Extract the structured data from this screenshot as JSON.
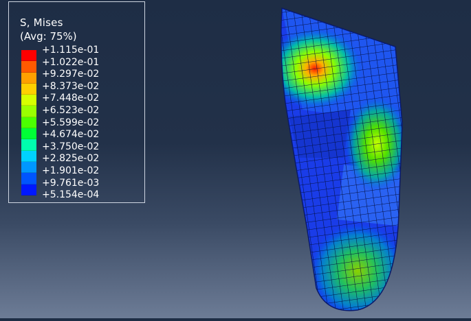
{
  "legend": {
    "title": "S, Mises",
    "subtitle": "(Avg: 75%)",
    "labels": [
      "+1.115e-01",
      "+1.022e-01",
      "+9.297e-02",
      "+8.373e-02",
      "+7.448e-02",
      "+6.523e-02",
      "+5.599e-02",
      "+4.674e-02",
      "+3.750e-02",
      "+2.825e-02",
      "+1.901e-02",
      "+9.761e-03",
      "+5.154e-04"
    ],
    "colors": [
      "#ff0000",
      "#ff5a00",
      "#ffa000",
      "#ffd000",
      "#d6ff00",
      "#9aff00",
      "#4cff00",
      "#00ff36",
      "#00ffae",
      "#00d2ff",
      "#0097ff",
      "#0055ff",
      "#0018ff"
    ]
  },
  "viewport": {
    "model": "foot-insole-mesh"
  }
}
